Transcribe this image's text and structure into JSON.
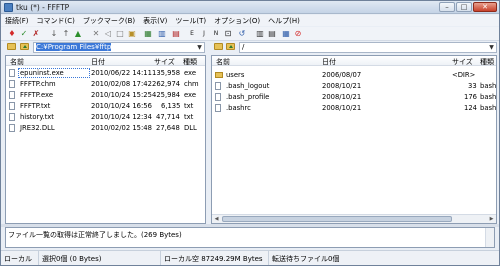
{
  "window": {
    "title": "tku (*) - FFFTP"
  },
  "menu": [
    "接続(F)",
    "コマンド(C)",
    "ブックマーク(B)",
    "表示(V)",
    "ツール(T)",
    "オプション(O)",
    "ヘルプ(H)"
  ],
  "toolbar": {
    "icons": [
      "connect-icon",
      "quick-connect-icon",
      "disconnect-icon",
      "download-icon",
      "upload-icon",
      "mirror-upload-icon",
      "delete-icon",
      "rename-icon",
      "mkdir-icon",
      "refresh-local-icon",
      "binary-mode-icon",
      "text-mode-icon",
      "auto-mode-icon",
      "kanji-euc-icon",
      "kanji-jis-icon",
      "kanji-none-icon",
      "kana-icon",
      "sync-icon",
      "list-view-icon",
      "detail-view-icon",
      "refresh-icon",
      "stop-icon"
    ]
  },
  "local": {
    "path": "C:¥Program Files¥fftp",
    "columns": {
      "name": "名前",
      "date": "日付",
      "size": "サイズ",
      "kind": "種類"
    },
    "files": [
      {
        "name": "epuninst.exe",
        "date": "2010/06/22 14:11",
        "size": "135,958",
        "kind": "exe",
        "type": "file"
      },
      {
        "name": "FFFTP.chm",
        "date": "2010/02/08 17:42",
        "size": "262,974",
        "kind": "chm",
        "type": "file"
      },
      {
        "name": "FFFTP.exe",
        "date": "2010/10/24 15:25",
        "size": "425,984",
        "kind": "exe",
        "type": "file"
      },
      {
        "name": "FFFTP.txt",
        "date": "2010/10/24 16:56",
        "size": "6,135",
        "kind": "txt",
        "type": "file"
      },
      {
        "name": "history.txt",
        "date": "2010/10/24 12:34",
        "size": "47,714",
        "kind": "txt",
        "type": "file"
      },
      {
        "name": "JRE32.DLL",
        "date": "2010/02/02 15:48",
        "size": "27,648",
        "kind": "DLL",
        "type": "file"
      }
    ]
  },
  "remote": {
    "path": "/",
    "columns": {
      "name": "名前",
      "date": "日付",
      "size": "サイズ",
      "kind": "種類"
    },
    "files": [
      {
        "name": "users",
        "date": "2006/08/07",
        "size": "<DIR>",
        "kind": "",
        "type": "dir"
      },
      {
        "name": ".bash_logout",
        "date": "2008/10/21",
        "size": "33",
        "kind": "bash_l",
        "type": "file"
      },
      {
        "name": ".bash_profile",
        "date": "2008/10/21",
        "size": "176",
        "kind": "bash_p",
        "type": "file"
      },
      {
        "name": ".bashrc",
        "date": "2008/10/21",
        "size": "124",
        "kind": "bashrc",
        "type": "file"
      }
    ]
  },
  "log": {
    "text": "ファイル一覧の取得は正常終了しました。(269 Bytes)"
  },
  "status": {
    "local": "ローカル",
    "selected": "選択0個 (0 Bytes)",
    "free": "ローカル空 87249.29M Bytes",
    "queue": "転送待ちファイル0個"
  }
}
